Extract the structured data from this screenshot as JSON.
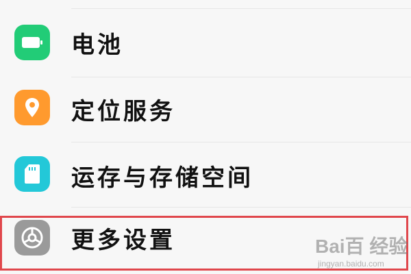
{
  "settings": {
    "items": [
      {
        "label": "电池",
        "icon": "battery-icon",
        "color": "#22cc77"
      },
      {
        "label": "定位服务",
        "icon": "location-pin-icon",
        "color": "#ff9a2e"
      },
      {
        "label": "运存与存储空间",
        "icon": "storage-card-icon",
        "color": "#23c8d8"
      },
      {
        "label": "更多设置",
        "icon": "gear-icon",
        "color": "#9a9a9a"
      }
    ],
    "highlighted_item": "更多设置",
    "highlight_color": "#e0474c"
  },
  "watermark": {
    "main": "Bai百 经验",
    "sub": "jingyan.baidu.com"
  }
}
